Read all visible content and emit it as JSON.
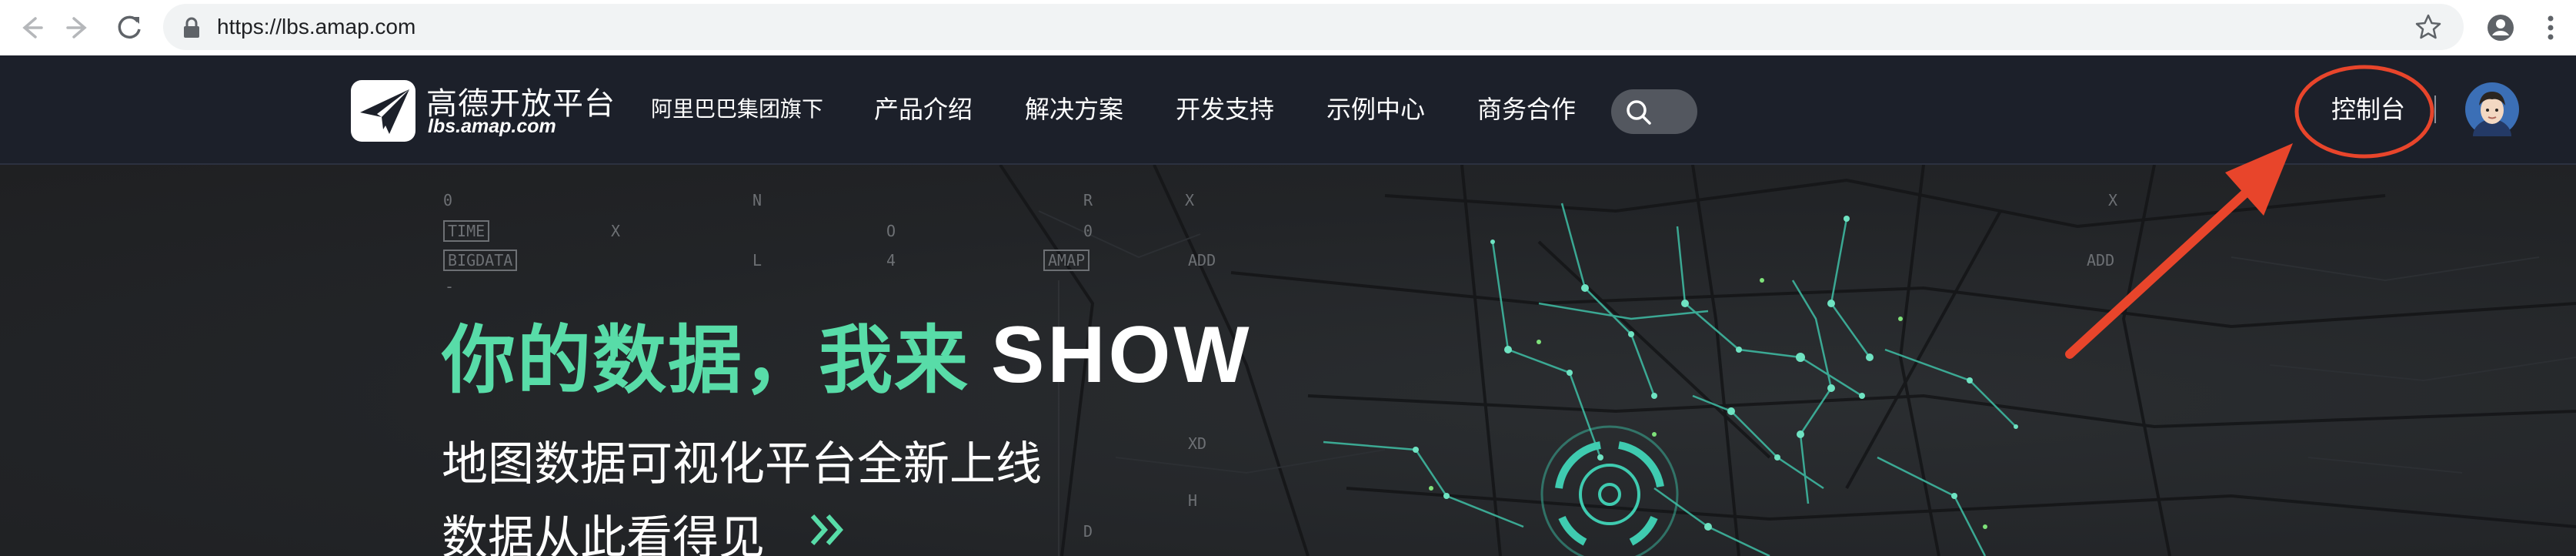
{
  "browser": {
    "url": "https://lbs.amap.com",
    "icons": [
      "back-icon",
      "forward-icon",
      "reload-icon",
      "lock-icon",
      "bookmark-star-icon",
      "profile-icon",
      "menu-kebab-icon"
    ]
  },
  "header": {
    "logo_title": "高德开放平台",
    "logo_domain": "lbs.amap.com",
    "group_text": "阿里巴巴集团旗下",
    "menu": [
      "产品介绍",
      "解决方案",
      "开发支持",
      "示例中心",
      "商务合作"
    ],
    "console_label": "控制台",
    "colors": {
      "background": "#1c202a",
      "search_pill": "#53575f"
    }
  },
  "hero": {
    "headline": "你的数据，我来",
    "headline_show": "SHOW",
    "subtitle_1": "地图数据可视化平台全新上线",
    "subtitle_2": "数据从此看得见",
    "hud_labels": {
      "zero_a": "0",
      "time": "TIME",
      "bigdata": "BIGDATA",
      "x_a": "X",
      "n": "N",
      "l": "L",
      "o": "O",
      "four": "4",
      "r": "R",
      "zero_b": "0",
      "amap": "AMAP",
      "x_b": "X",
      "add_a": "ADD",
      "xd": "XD",
      "h": "H",
      "d": "D",
      "x_c": "X",
      "add_b": "ADD",
      "dash": "-"
    },
    "colors": {
      "accent_green": "#58dca8",
      "route_teal": "#3fbfa6"
    }
  },
  "annotation": {
    "color": "#e8452b"
  }
}
